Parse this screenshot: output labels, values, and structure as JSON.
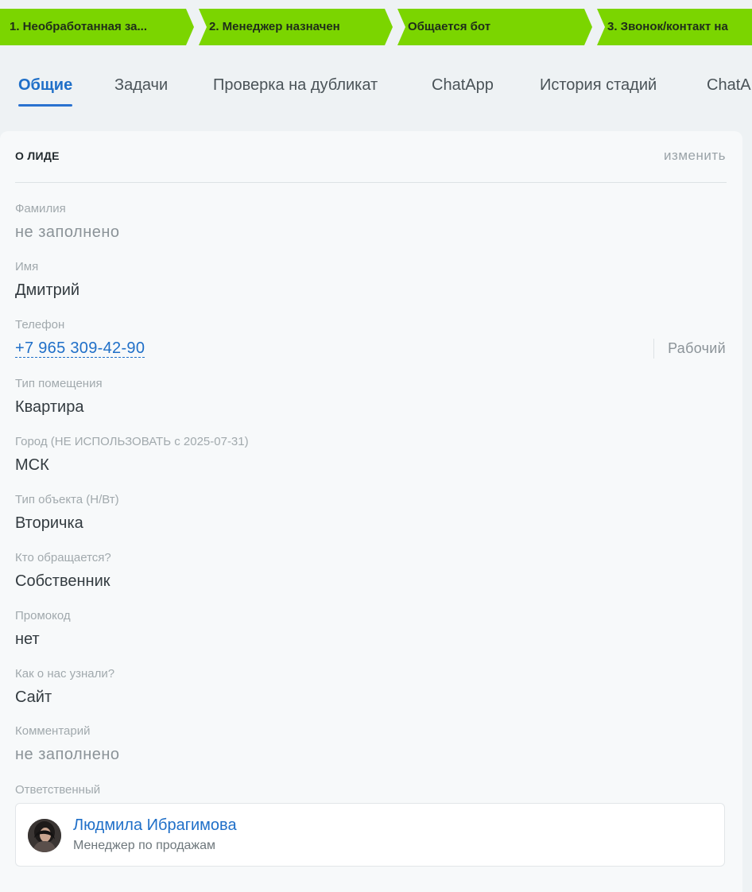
{
  "stages": [
    {
      "label": "1. Необработанная за..."
    },
    {
      "label": "2. Менеджер назначен"
    },
    {
      "label": "Общается бот"
    },
    {
      "label": "3. Звонок/контакт на"
    }
  ],
  "tabs": [
    {
      "label": "Общие",
      "active": true
    },
    {
      "label": "Задачи"
    },
    {
      "label": "Проверка на дубликат"
    },
    {
      "label": "ChatApp"
    },
    {
      "label": "История стадий"
    },
    {
      "label": "ChatA"
    }
  ],
  "card": {
    "title": "О ЛИДЕ",
    "edit_label": "изменить",
    "fields": {
      "surname": {
        "label": "Фамилия",
        "value": "не заполнено"
      },
      "name": {
        "label": "Имя",
        "value": "Дмитрий"
      },
      "phone": {
        "label": "Телефон",
        "value": "+7 965 309-42-90",
        "type": "Рабочий"
      },
      "room_type": {
        "label": "Тип помещения",
        "value": "Квартира"
      },
      "city": {
        "label": "Город (НЕ ИСПОЛЬЗОВАТЬ с 2025-07-31)",
        "value": "МСК"
      },
      "object_type": {
        "label": "Тип объекта (Н/Вт)",
        "value": "Вторичка"
      },
      "who": {
        "label": "Кто обращается?",
        "value": "Собственник"
      },
      "promo": {
        "label": "Промокод",
        "value": "нет"
      },
      "source": {
        "label": "Как о нас узнали?",
        "value": "Сайт"
      },
      "comment": {
        "label": "Комментарий",
        "value": "не заполнено"
      }
    },
    "responsible": {
      "label": "Ответственный",
      "name": "Людмила Ибрагимова",
      "role": "Менеджер по продажам"
    }
  },
  "colors": {
    "stage_bg": "#7bd500",
    "accent": "#1f6fc8",
    "page_bg": "#eef2f4",
    "card_bg": "#f7f9fa"
  }
}
